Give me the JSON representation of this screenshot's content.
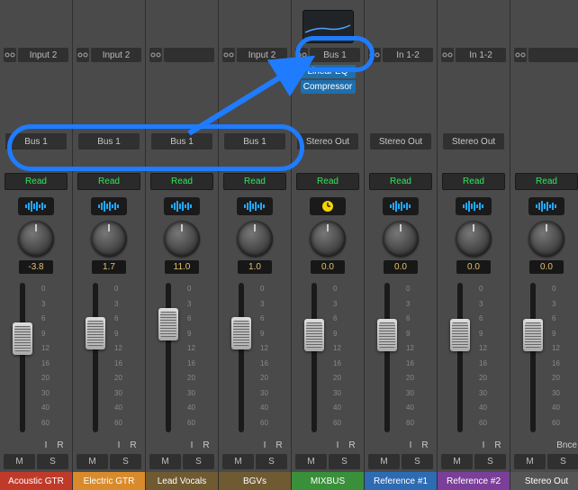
{
  "channels": [
    {
      "input": "Input 2",
      "showEq": false,
      "plugins": [],
      "output": "Bus 1",
      "read": "Read",
      "meter": "wave",
      "pan": "-3.8",
      "faderTop": 44,
      "name": "Acoustic GTR",
      "color": "#c03a2a",
      "ir": "IR",
      "ms": [
        "M",
        "S"
      ]
    },
    {
      "input": "Input 2",
      "showEq": false,
      "plugins": [],
      "output": "Bus 1",
      "read": "Read",
      "meter": "wave",
      "pan": "1.7",
      "faderTop": 38,
      "name": "Electric GTR",
      "color": "#d98b2b",
      "ir": "IR",
      "ms": [
        "M",
        "S"
      ]
    },
    {
      "input": "",
      "showEq": false,
      "plugins": [],
      "output": "Bus 1",
      "read": "Read",
      "meter": "wave",
      "pan": "11.0",
      "faderTop": 28,
      "name": "Lead Vocals",
      "color": "#6f5a32",
      "ir": "IR",
      "ms": [
        "M",
        "S"
      ]
    },
    {
      "input": "Input 2",
      "showEq": false,
      "plugins": [],
      "output": "Bus 1",
      "read": "Read",
      "meter": "wave",
      "pan": "1.0",
      "faderTop": 38,
      "name": "BGVs",
      "color": "#6f5a32",
      "ir": "IR",
      "ms": [
        "M",
        "S"
      ]
    },
    {
      "input": "Bus 1",
      "showEq": true,
      "plugins": [
        "Linear EQ",
        "Compressor"
      ],
      "output": "Stereo Out",
      "read": "Read",
      "meter": "clock",
      "pan": "0.0",
      "faderTop": 40,
      "name": "MIXBUS",
      "color": "#3a8f3a",
      "ir": "IR",
      "ms": [
        "M",
        "S"
      ]
    },
    {
      "input": "In 1-2",
      "showEq": false,
      "plugins": [],
      "output": "Stereo Out",
      "read": "Read",
      "meter": "wave",
      "pan": "0.0",
      "faderTop": 40,
      "name": "Reference #1",
      "color": "#2d6bb3",
      "ir": "IR",
      "ms": [
        "M",
        "S"
      ]
    },
    {
      "input": "In 1-2",
      "showEq": false,
      "plugins": [],
      "output": "Stereo Out",
      "read": "Read",
      "meter": "wave",
      "pan": "0.0",
      "faderTop": 40,
      "name": "Reference #2",
      "color": "#7a3f99",
      "ir": "IR",
      "ms": [
        "M",
        "S"
      ]
    },
    {
      "input": "",
      "showEq": false,
      "plugins": [],
      "output": "",
      "read": "Read",
      "meter": "wave",
      "pan": "0.0",
      "faderTop": 40,
      "name": "Stereo Out",
      "color": "#555",
      "ir": "Bnce",
      "ms": [
        "M",
        "S"
      ],
      "partial": true
    }
  ],
  "scale": [
    "0",
    "3",
    "6",
    "9",
    "12",
    "16",
    "20",
    "30",
    "40",
    "60"
  ]
}
